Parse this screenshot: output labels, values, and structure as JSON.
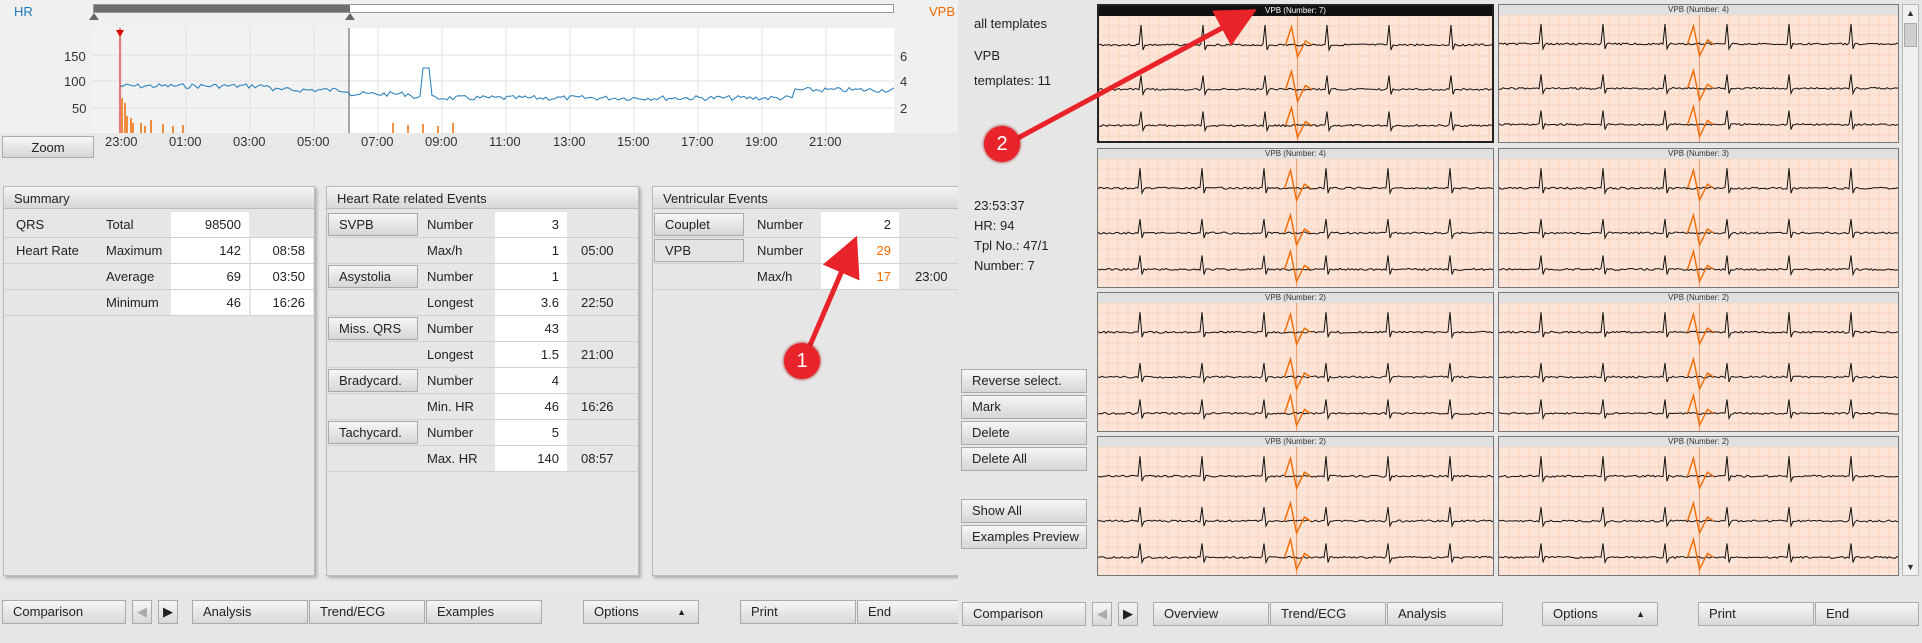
{
  "trend": {
    "hr_label": "HR",
    "vpb_label": "VPB",
    "left_ticks": [
      "150",
      "100",
      "50"
    ],
    "right_ticks": [
      "6",
      "4",
      "2"
    ],
    "zoom_label": "Zoom",
    "time_ticks": [
      "23:00",
      "01:00",
      "03:00",
      "05:00",
      "07:00",
      "09:00",
      "11:00",
      "13:00",
      "15:00",
      "17:00",
      "19:00",
      "21:00"
    ],
    "colors": {
      "hr": "#1f7ab8",
      "vpb": "#f06a00"
    }
  },
  "summary": {
    "title": "Summary",
    "rows": [
      {
        "label": "QRS",
        "sub": "Total",
        "value": "98500",
        "time": ""
      },
      {
        "label": "Heart Rate",
        "sub": "Maximum",
        "value": "142",
        "time": "08:58"
      },
      {
        "label": "",
        "sub": "Average",
        "value": "69",
        "time": "03:50"
      },
      {
        "label": "",
        "sub": "Minimum",
        "value": "46",
        "time": "16:26"
      }
    ]
  },
  "hr_events": {
    "title": "Heart Rate related Events",
    "groups": [
      {
        "button": "SVPB",
        "rows": [
          {
            "label": "Number",
            "value": "3",
            "time": ""
          },
          {
            "label": "Max/h",
            "value": "1",
            "time": "05:00"
          }
        ]
      },
      {
        "button": "Asystolia",
        "rows": [
          {
            "label": "Number",
            "value": "1",
            "time": ""
          },
          {
            "label": "Longest",
            "value": "3.6",
            "time": "22:50"
          }
        ]
      },
      {
        "button": "Miss. QRS",
        "rows": [
          {
            "label": "Number",
            "value": "43",
            "time": ""
          },
          {
            "label": "Longest",
            "value": "1.5",
            "time": "21:00"
          }
        ]
      },
      {
        "button": "Bradycard.",
        "rows": [
          {
            "label": "Number",
            "value": "4",
            "time": ""
          },
          {
            "label": "Min. HR",
            "value": "46",
            "time": "16:26"
          }
        ]
      },
      {
        "button": "Tachycard.",
        "rows": [
          {
            "label": "Number",
            "value": "5",
            "time": ""
          },
          {
            "label": "Max. HR",
            "value": "140",
            "time": "08:57"
          }
        ]
      }
    ]
  },
  "ventricular": {
    "title": "Ventricular Events",
    "couplet": {
      "button": "Couplet",
      "label": "Number",
      "value": "2"
    },
    "vpb": {
      "button": "VPB",
      "label": "Number",
      "value": "29",
      "label2": "Max/h",
      "value2": "17",
      "time2": "23:00"
    }
  },
  "left_bottom": {
    "comparison": "Comparison",
    "analysis": "Analysis",
    "trend_ecg": "Trend/ECG",
    "examples": "Examples",
    "options": "Options",
    "print": "Print",
    "end": "End"
  },
  "right_panel": {
    "all_templates": "all templates",
    "type": "VPB",
    "templates_count": "templates: 11",
    "time": "23:53:37",
    "hr": "HR: 94",
    "tpl_no": "Tpl No.: 47/1",
    "number": "Number: 7",
    "reverse_select": "Reverse select.",
    "mark": "Mark",
    "delete": "Delete",
    "delete_all": "Delete All",
    "show_all": "Show All",
    "examples_preview": "Examples Preview",
    "templates": [
      "VPB (Number: 7)",
      "VPB (Number: 4)",
      "VPB (Number: 4)",
      "VPB (Number: 3)",
      "VPB (Number: 2)",
      "VPB (Number: 2)",
      "VPB (Number: 2)",
      "VPB (Number: 2)"
    ]
  },
  "right_bottom": {
    "comparison": "Comparison",
    "overview": "Overview",
    "trend_ecg": "Trend/ECG",
    "analysis": "Analysis",
    "options": "Options",
    "print": "Print",
    "end": "End"
  },
  "annotations": {
    "badge1": "1",
    "badge2": "2"
  }
}
